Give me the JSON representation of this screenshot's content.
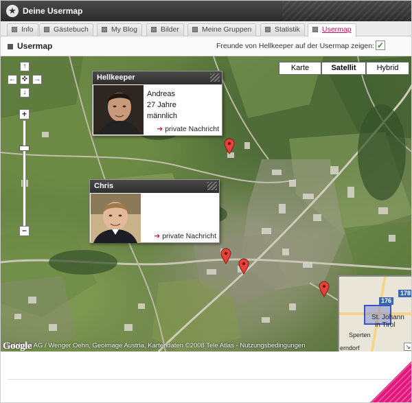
{
  "window": {
    "title": "Deine Usermap"
  },
  "tabs": [
    {
      "label": "Info",
      "active": false
    },
    {
      "label": "Gästebuch",
      "active": false
    },
    {
      "label": "My Blog",
      "active": false
    },
    {
      "label": "Bilder",
      "active": false
    },
    {
      "label": "Meine Gruppen",
      "active": false
    },
    {
      "label": "Statistik",
      "active": false
    },
    {
      "label": "Usermap",
      "active": true
    }
  ],
  "section": {
    "heading": "Usermap",
    "option_label": "Freunde von Hellkeeper auf der Usermap zeigen:",
    "option_checked": true,
    "check_glyph": "✓"
  },
  "map": {
    "type_buttons": [
      "Karte",
      "Satellit",
      "Hybrid"
    ],
    "selected_type": "Satellit",
    "controls": {
      "pan_up": "↑",
      "pan_left": "←",
      "pan_center": "✜",
      "pan_right": "→",
      "pan_down": "↓",
      "zoom_in": "+",
      "zoom_out": "−"
    },
    "attribution": "Salzburg AG / Wenger Oehn, Geoimage Austria, Kartendaten ©2008 Tele Atlas - Nutzungsbedingungen",
    "logo": "Google",
    "overview": {
      "labels": [
        "176",
        "178",
        "St. Johann",
        "in Tirol",
        "Sperten",
        "erndorf"
      ]
    }
  },
  "users": [
    {
      "username": "Hellkeeper",
      "firstname": "Andreas",
      "age": "27 Jahre",
      "gender": "männlich",
      "message_link": "private Nachricht",
      "arrow": "➔"
    },
    {
      "username": "Chris",
      "firstname": "",
      "age": "",
      "gender": "",
      "message_link": "private Nachricht",
      "arrow": "➔"
    }
  ],
  "icons": {
    "window": "star-icon",
    "tab": "tab-square-icon",
    "marker": "map-marker-icon",
    "close": "close-icon"
  },
  "colors": {
    "accent": "#c0105a",
    "marker": "#e0443a",
    "header_dark": "#2e2e2e",
    "corner_pink": "#e2187c"
  }
}
